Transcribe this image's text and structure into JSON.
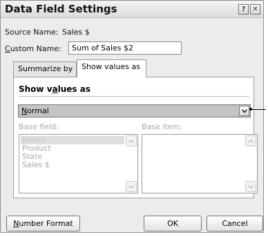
{
  "dialog": {
    "title": "Data Field Settings",
    "help_button": "?",
    "close_button": "✕"
  },
  "source": {
    "label": "Source Name:",
    "value": "Sales $"
  },
  "custom": {
    "label_mnemonic": "C",
    "label_rest": "ustom Name:",
    "value": "Sum of Sales $2"
  },
  "tabs": [
    {
      "label": "Summarize by",
      "active": false
    },
    {
      "label": "Show values as",
      "active": true
    }
  ],
  "show_values": {
    "title_pre": "Show v",
    "title_mnemonic": "a",
    "title_post": "lues as",
    "selected_mnemonic": "N",
    "selected_rest": "ormal"
  },
  "base_field": {
    "label": "Base field:",
    "items": [
      "Month",
      "Product",
      "State",
      "Sales $"
    ],
    "selected_index": 0
  },
  "base_item": {
    "label": "Base item:",
    "items": []
  },
  "buttons": {
    "number_format_mnemonic": "N",
    "number_format_rest": "umber Format",
    "ok": "OK",
    "cancel": "Cancel"
  },
  "colors": {
    "dialog_bg": "#ececec",
    "combo_selected_bg": "#c4c4c4",
    "disabled_text": "#a8a8a8"
  }
}
